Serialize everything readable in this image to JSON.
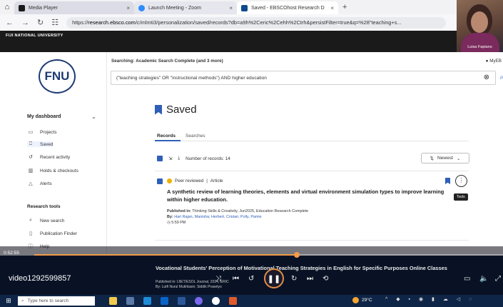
{
  "player": {
    "tabs": [
      {
        "label": "Media Player",
        "close": "×"
      },
      {
        "label": "Launch Meeting - Zoom",
        "close": "×"
      },
      {
        "label": "Saved - EBSCOhost Research D",
        "close": "×"
      }
    ],
    "new_tab": "+"
  },
  "browser": {
    "url_prefix": "https://",
    "url_host": "research.ebsco.com",
    "url_rest": "/c/mlmti3/personalization/saved/records?db=a9h%2Ceric%2Cehh%2Ctrh&persistFilter=true&q=%28\"teaching+s..."
  },
  "banner": {
    "text": "FIJI NATIONAL UNIVERSITY"
  },
  "webcam": {
    "participant_name": "Luisa Fapiano"
  },
  "sidebar": {
    "logo_text": "FNU",
    "dashboard_label": "My dashboard",
    "items": [
      {
        "label": "Projects"
      },
      {
        "label": "Saved"
      },
      {
        "label": "Recent activity"
      },
      {
        "label": "Holds & checkouts"
      },
      {
        "label": "Alerts"
      }
    ],
    "research_tools_label": "Research tools",
    "tools": [
      {
        "label": "New search"
      },
      {
        "label": "Publication Finder"
      },
      {
        "label": "Help"
      }
    ]
  },
  "main": {
    "searching_label": "Searching:",
    "searching_value": "Academic Search Complete (and 3 more)",
    "account_label": "MyEB",
    "query": "(\"teaching strategies\" OR \"instructional methods\") AND higher education",
    "page_title": "Saved",
    "tabs": [
      {
        "label": "Records"
      },
      {
        "label": "Searches"
      }
    ],
    "records_count_label": "Number of records: 14",
    "sort_label": "Newest",
    "record1": {
      "badge": "Peer reviewed",
      "type": "Article",
      "title": "A synthetic review of learning theories, elements and virtual environment simulation types to improve learning within higher education.",
      "published_label": "Published in:",
      "published_value": "Thinking Skills & Creativity, Jun2025, Education Research Complete",
      "by_label": "By:",
      "authors": "Hari Rajan, Manisha; Herbert, Cristan; Polly, Pamie",
      "time": "5:59 PM",
      "tooltip": "Tools"
    },
    "record2": {
      "title": "Vocational Students' Perception of Motivational Teaching Strategies in English for Specific Purposes Online Classes",
      "published": "Published in: IJIET/ESOL Journal, 2024, ERIC",
      "by": "By: Lutfi Nurul Mukhlasin; Siddik Prasetyo"
    }
  },
  "video": {
    "time": "0:52:55",
    "name": "video1292599857",
    "progress": 0.56
  },
  "taskbar": {
    "search_placeholder": "Type here to search",
    "temperature": "29°C"
  },
  "colors": {
    "accent": "#2f5fb8",
    "progress": "#f29a4a",
    "taskbar": "#0e2547"
  }
}
